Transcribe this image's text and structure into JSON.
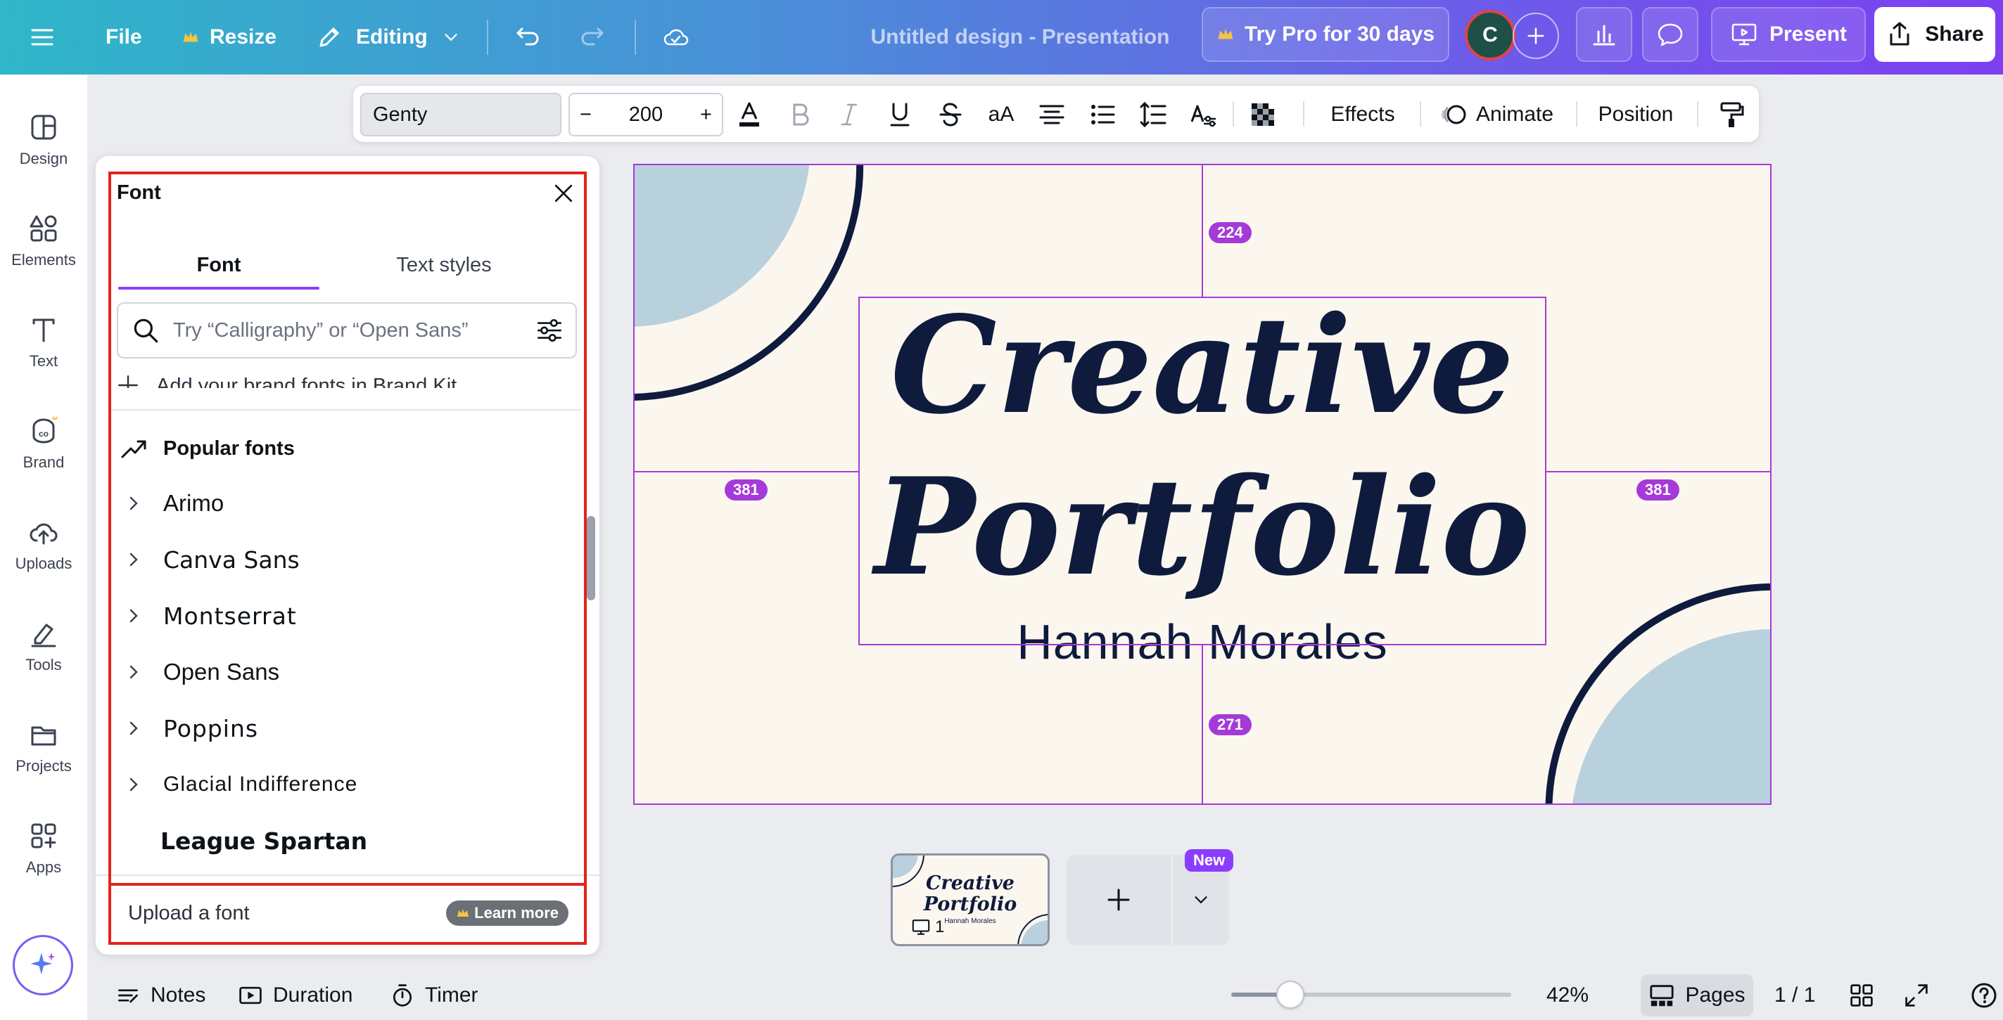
{
  "header": {
    "menu_icon": "hamburger-icon",
    "file_label": "File",
    "resize_label": "Resize",
    "editing_label": "Editing",
    "document_title": "Untitled design - Presentation",
    "try_pro_label": "Try Pro for 30 days",
    "avatar_initial": "C",
    "present_label": "Present",
    "share_label": "Share"
  },
  "sidebar": {
    "items": [
      {
        "label": "Design",
        "icon": "design-icon"
      },
      {
        "label": "Elements",
        "icon": "elements-icon"
      },
      {
        "label": "Text",
        "icon": "text-icon"
      },
      {
        "label": "Brand",
        "icon": "brand-icon"
      },
      {
        "label": "Uploads",
        "icon": "uploads-icon"
      },
      {
        "label": "Tools",
        "icon": "tools-icon"
      },
      {
        "label": "Projects",
        "icon": "projects-icon"
      },
      {
        "label": "Apps",
        "icon": "apps-icon"
      }
    ]
  },
  "toolbar": {
    "font_name": "Genty",
    "font_size": "200",
    "minus": "−",
    "plus": "+",
    "case_label": "aA",
    "effects_label": "Effects",
    "animate_label": "Animate",
    "position_label": "Position"
  },
  "font_panel": {
    "title": "Font",
    "tabs": [
      {
        "label": "Font",
        "active": true
      },
      {
        "label": "Text styles",
        "active": false
      }
    ],
    "search_placeholder": "Try “Calligraphy” or “Open Sans”",
    "brand_kit_text": "Add your brand fonts in Brand Kit",
    "section_title": "Popular fonts",
    "fonts": [
      "Arimo",
      "Canva Sans",
      "Montserrat",
      "Open Sans",
      "Poppins",
      "Glacial Indifference"
    ],
    "last_font": "League Spartan",
    "upload_label": "Upload a font",
    "learn_more_label": "Learn more"
  },
  "canvas": {
    "title_line1": "Creative",
    "title_line2": "Portfolio",
    "subtitle": "Hannah Morales",
    "measure_top": "224",
    "measure_left": "381",
    "measure_right": "381",
    "measure_bottom": "271",
    "colors": {
      "background": "#fbf7ef",
      "text": "#0f1b3d",
      "accent_circle": "#b9d1dd",
      "guide": "#a53ad8"
    }
  },
  "pages_strip": {
    "thumb_title_line1": "Creative",
    "thumb_title_line2": "Portfolio",
    "thumb_subtitle": "Hannah Morales",
    "page_number": "1",
    "new_badge": "New"
  },
  "bottom_bar": {
    "notes_label": "Notes",
    "duration_label": "Duration",
    "timer_label": "Timer",
    "zoom_level": "42%",
    "zoom_fraction": 0.21,
    "pages_label": "Pages",
    "page_count": "1 / 1"
  }
}
